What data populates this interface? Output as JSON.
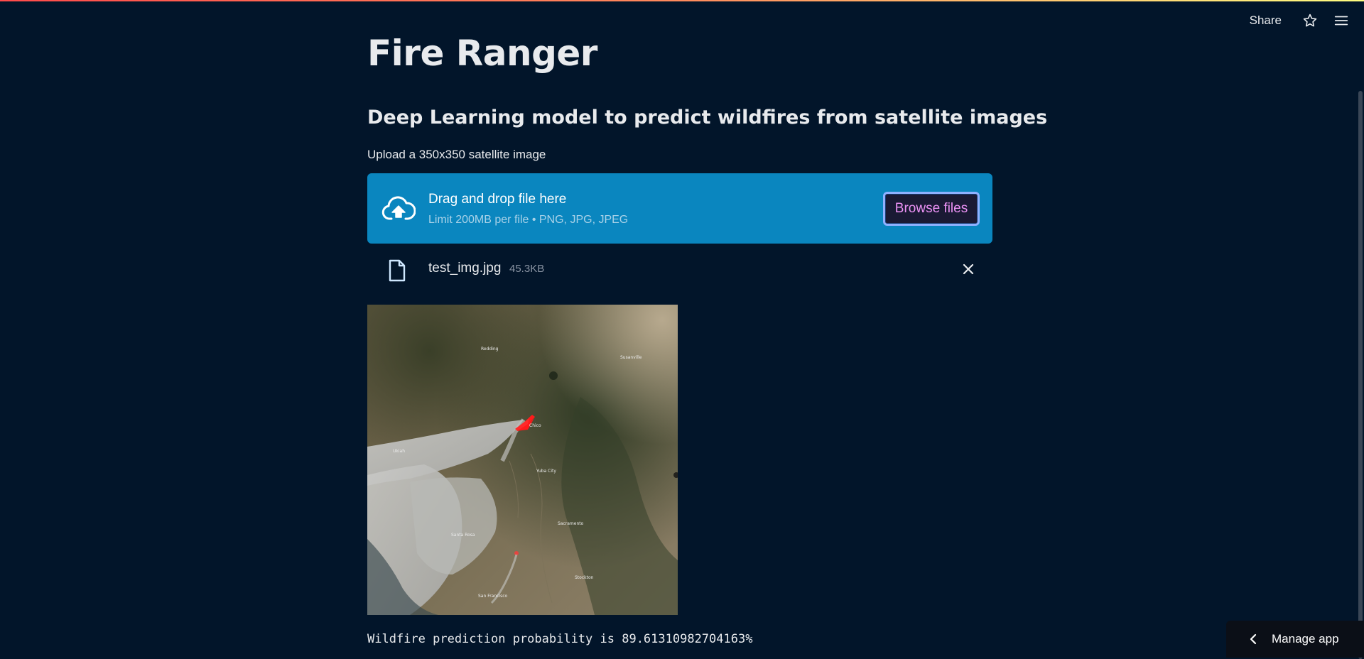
{
  "header": {
    "share_label": "Share",
    "star_icon": "star-icon",
    "menu_icon": "hamburger-menu-icon"
  },
  "app": {
    "title": "Fire Ranger",
    "subtitle": "Deep Learning model to predict wildfires from satellite images"
  },
  "uploader": {
    "label": "Upload a 350x350 satellite image",
    "dropzone_title": "Drag and drop file here",
    "dropzone_limit": "Limit 200MB per file • PNG, JPG, JPEG",
    "browse_label": "Browse files",
    "upload_icon": "cloud-upload-icon"
  },
  "uploaded_file": {
    "name": "test_img.jpg",
    "size": "45.3KB",
    "file_icon": "file-icon",
    "remove_icon": "close-icon"
  },
  "satellite_image": {
    "labels": [
      "Redding",
      "Susanville",
      "Chico",
      "Ukiah",
      "Yuba City",
      "Santa Rosa",
      "Sacramento",
      "Stockton",
      "San Francisco"
    ]
  },
  "result": {
    "prediction_text": "Wildfire prediction probability is 89.61310982704163%"
  },
  "footer": {
    "manage_app_label": "Manage app"
  },
  "colors": {
    "background": "#02152a",
    "dropzone": "#0a86bf",
    "browse_text": "#ec92f5",
    "fire": "#ff1a1a"
  }
}
